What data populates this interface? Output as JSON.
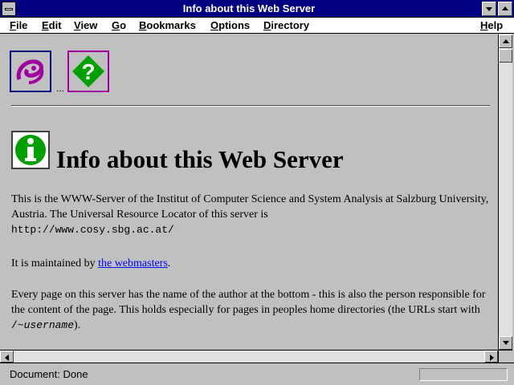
{
  "window": {
    "title": "Info about this Web Server"
  },
  "menu": [
    "File",
    "Edit",
    "View",
    "Go",
    "Bookmarks",
    "Options",
    "Directory",
    "Help"
  ],
  "toolbar": {
    "ellipsis": "..."
  },
  "page": {
    "heading": "Info about this Web Server",
    "p1_text": "This is the WWW-Server of the Institut of Computer Science and System Analysis at Salzburg University, Austria. The Universal Resource Locator of this server is",
    "p1_url": "http://www.cosy.sbg.ac.at/",
    "p2_prefix": "It is maintained by ",
    "p2_link": "the webmasters",
    "p2_suffix": ".",
    "p3_text": "Every page on this server has the name of the author at the bottom - this is also the person responsible for the content of the page. This holds especially for pages in peoples home directories (the URLs start with ",
    "p3_code_prefix": "/~",
    "p3_code_italic": "username",
    "p3_suffix": ")."
  },
  "status": {
    "text": "Document: Done"
  },
  "icons": {
    "sys": "system-menu-icon",
    "home": "web-logo-icon",
    "help": "help-question-icon",
    "info": "info-icon"
  }
}
